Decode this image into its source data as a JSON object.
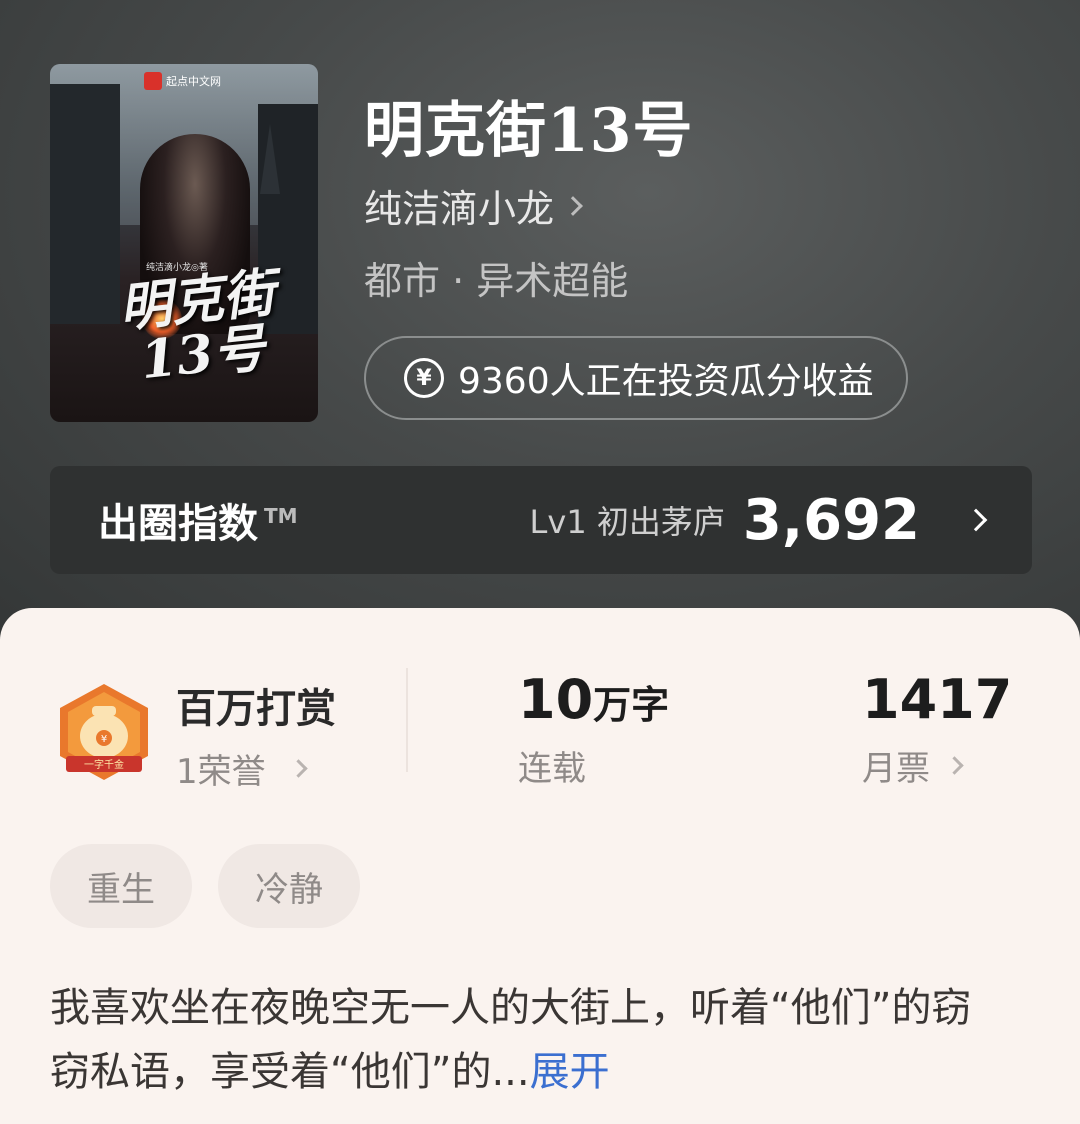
{
  "book": {
    "title": "明克街13号",
    "author": "纯洁滴小龙",
    "genre": "都市 · 异术超能",
    "invest_text": "9360人正在投资瓜分收益",
    "invest_icon": "yen-circle-icon",
    "cover": {
      "publisher": "起点中文网",
      "author_credit": "纯洁滴小龙◎著",
      "title_art": "明克街13号"
    }
  },
  "index": {
    "label": "出圈指数",
    "tm": "TM",
    "level": "Lv1 初出茅庐",
    "score": "3,692"
  },
  "stats": {
    "reward": {
      "title": "百万打赏",
      "sub": "1荣誉",
      "badge_text": "一字千金"
    },
    "words": {
      "num": "10",
      "unit": "万字",
      "sub": "连载"
    },
    "tickets": {
      "num": "1417",
      "sub": "月票"
    }
  },
  "tags": [
    "重生",
    "冷静"
  ],
  "description": {
    "text": "我喜欢坐在夜晚空无一人的大街上，听着“他们”的窃窃私语，享受着“他们”的...",
    "more": "展开"
  },
  "colors": {
    "hero_bg": "#474a4a",
    "panel_bg": "#faf3ef",
    "link": "#3b6fd0",
    "badge_orange": "#e9782c"
  }
}
